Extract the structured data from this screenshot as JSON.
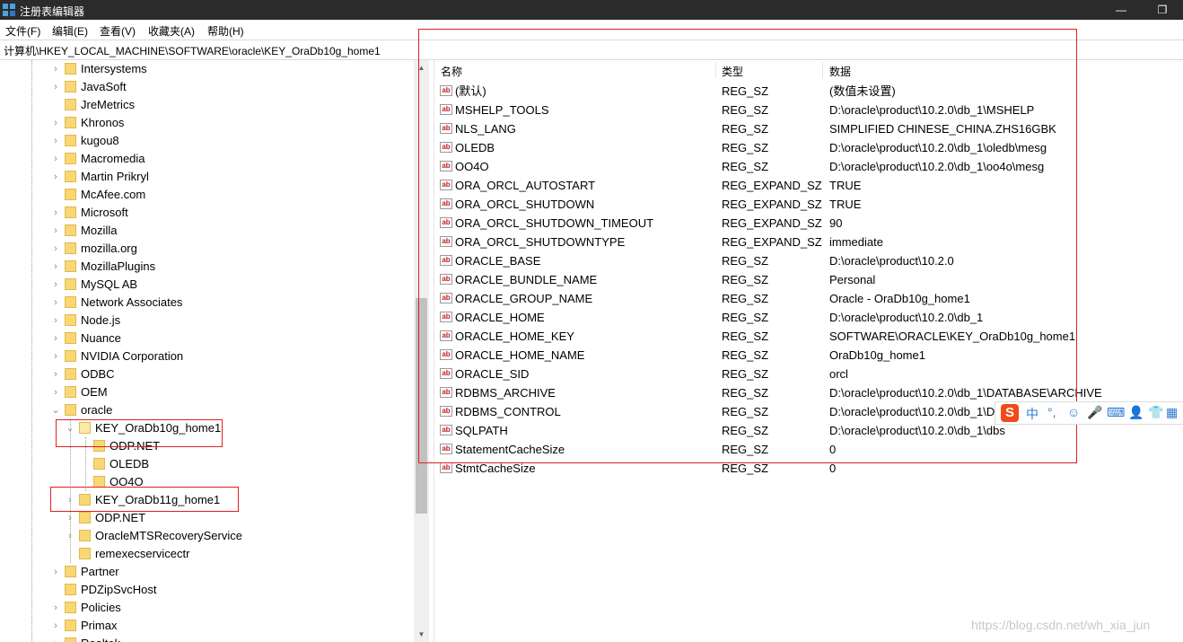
{
  "window": {
    "title": "注册表编辑器",
    "restore_glyph": "❐",
    "minimize_glyph": "—"
  },
  "menu": [
    {
      "label": "文件(F)"
    },
    {
      "label": "编辑(E)"
    },
    {
      "label": "查看(V)"
    },
    {
      "label": "收藏夹(A)"
    },
    {
      "label": "帮助(H)"
    }
  ],
  "address": "计算机\\HKEY_LOCAL_MACHINE\\SOFTWARE\\oracle\\KEY_OraDb10g_home1",
  "tree": [
    {
      "label": "Intersystems",
      "expander": ">"
    },
    {
      "label": "JavaSoft",
      "expander": ">"
    },
    {
      "label": "JreMetrics",
      "expander": ""
    },
    {
      "label": "Khronos",
      "expander": ">"
    },
    {
      "label": "kugou8",
      "expander": ">"
    },
    {
      "label": "Macromedia",
      "expander": ">"
    },
    {
      "label": "Martin Prikryl",
      "expander": ">"
    },
    {
      "label": "McAfee.com",
      "expander": ""
    },
    {
      "label": "Microsoft",
      "expander": ">"
    },
    {
      "label": "Mozilla",
      "expander": ">"
    },
    {
      "label": "mozilla.org",
      "expander": ">"
    },
    {
      "label": "MozillaPlugins",
      "expander": ">"
    },
    {
      "label": "MySQL AB",
      "expander": ">"
    },
    {
      "label": "Network Associates",
      "expander": ">"
    },
    {
      "label": "Node.js",
      "expander": ">"
    },
    {
      "label": "Nuance",
      "expander": ">"
    },
    {
      "label": "NVIDIA Corporation",
      "expander": ">"
    },
    {
      "label": "ODBC",
      "expander": ">"
    },
    {
      "label": "OEM",
      "expander": ">"
    },
    {
      "label": "oracle",
      "expander": "v"
    },
    {
      "label": "KEY_OraDb10g_home1",
      "expander": "v",
      "selected": true
    },
    {
      "label": "ODP.NET",
      "expander": ""
    },
    {
      "label": "OLEDB",
      "expander": ""
    },
    {
      "label": "OO4O",
      "expander": ""
    },
    {
      "label": "KEY_OraDb11g_home1",
      "expander": ">"
    },
    {
      "label": "ODP.NET",
      "expander": ">"
    },
    {
      "label": "OracleMTSRecoveryService",
      "expander": ">"
    },
    {
      "label": "remexecservicectr",
      "expander": ""
    },
    {
      "label": "Partner",
      "expander": ">"
    },
    {
      "label": "PDZipSvcHost",
      "expander": ""
    },
    {
      "label": "Policies",
      "expander": ">"
    },
    {
      "label": "Primax",
      "expander": ">"
    },
    {
      "label": "Realtek",
      "expander": ">"
    }
  ],
  "list": {
    "headers": {
      "name": "名称",
      "type": "类型",
      "data": "数据"
    },
    "rows": [
      {
        "name": "(默认)",
        "type": "REG_SZ",
        "data": "(数值未设置)"
      },
      {
        "name": "MSHELP_TOOLS",
        "type": "REG_SZ",
        "data": "D:\\oracle\\product\\10.2.0\\db_1\\MSHELP"
      },
      {
        "name": "NLS_LANG",
        "type": "REG_SZ",
        "data": "SIMPLIFIED CHINESE_CHINA.ZHS16GBK"
      },
      {
        "name": "OLEDB",
        "type": "REG_SZ",
        "data": "D:\\oracle\\product\\10.2.0\\db_1\\oledb\\mesg"
      },
      {
        "name": "OO4O",
        "type": "REG_SZ",
        "data": "D:\\oracle\\product\\10.2.0\\db_1\\oo4o\\mesg"
      },
      {
        "name": "ORA_ORCL_AUTOSTART",
        "type": "REG_EXPAND_SZ",
        "data": "TRUE"
      },
      {
        "name": "ORA_ORCL_SHUTDOWN",
        "type": "REG_EXPAND_SZ",
        "data": "TRUE"
      },
      {
        "name": "ORA_ORCL_SHUTDOWN_TIMEOUT",
        "type": "REG_EXPAND_SZ",
        "data": "90"
      },
      {
        "name": "ORA_ORCL_SHUTDOWNTYPE",
        "type": "REG_EXPAND_SZ",
        "data": "immediate"
      },
      {
        "name": "ORACLE_BASE",
        "type": "REG_SZ",
        "data": "D:\\oracle\\product\\10.2.0"
      },
      {
        "name": "ORACLE_BUNDLE_NAME",
        "type": "REG_SZ",
        "data": "Personal"
      },
      {
        "name": "ORACLE_GROUP_NAME",
        "type": "REG_SZ",
        "data": "Oracle - OraDb10g_home1"
      },
      {
        "name": "ORACLE_HOME",
        "type": "REG_SZ",
        "data": "D:\\oracle\\product\\10.2.0\\db_1"
      },
      {
        "name": "ORACLE_HOME_KEY",
        "type": "REG_SZ",
        "data": "SOFTWARE\\ORACLE\\KEY_OraDb10g_home1"
      },
      {
        "name": "ORACLE_HOME_NAME",
        "type": "REG_SZ",
        "data": "OraDb10g_home1"
      },
      {
        "name": "ORACLE_SID",
        "type": "REG_SZ",
        "data": "orcl"
      },
      {
        "name": "RDBMS_ARCHIVE",
        "type": "REG_SZ",
        "data": "D:\\oracle\\product\\10.2.0\\db_1\\DATABASE\\ARCHIVE"
      },
      {
        "name": "RDBMS_CONTROL",
        "type": "REG_SZ",
        "data": "D:\\oracle\\product\\10.2.0\\db_1\\D"
      },
      {
        "name": "SQLPATH",
        "type": "REG_SZ",
        "data": "D:\\oracle\\product\\10.2.0\\db_1\\dbs"
      },
      {
        "name": "StatementCacheSize",
        "type": "REG_SZ",
        "data": "0"
      },
      {
        "name": "StmtCacheSize",
        "type": "REG_SZ",
        "data": "0"
      }
    ],
    "value_icon_text": "ab"
  },
  "ime": {
    "logo": "S",
    "items": [
      "中",
      "°,",
      "☺",
      "🎤",
      "⌨",
      "👤",
      "👕",
      "▦"
    ]
  },
  "watermark": "https://blog.csdn.net/wh_xia_jun",
  "colors": {
    "annotation_red": "#e02020",
    "title_bg": "#2b2b2b",
    "folder": "#f8d775"
  }
}
